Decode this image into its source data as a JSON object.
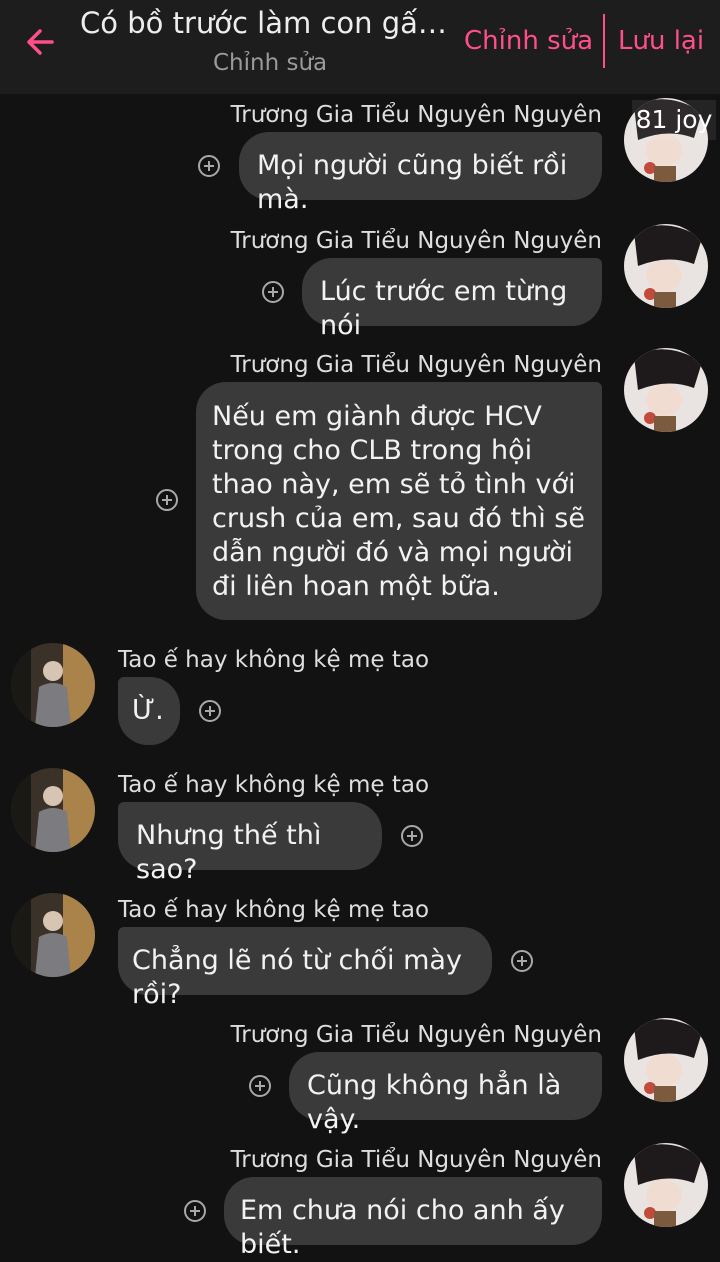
{
  "header": {
    "title": "Có bồ trước làm con gấu ...",
    "subtitle": "Chỉnh sửa",
    "edit_label": "Chỉnh sửa",
    "save_label": "Lưu lại"
  },
  "watermark": "81 joy",
  "colors": {
    "accent": "#ff4f8a",
    "bubble": "#3a3a3a",
    "background": "#121212"
  },
  "messages": [
    {
      "side": "right",
      "sender": "Trương Gia Tiểu Nguyên Nguyên",
      "text": "Mọi người cũng biết rồi mà."
    },
    {
      "side": "right",
      "sender": "Trương Gia Tiểu Nguyên Nguyên",
      "text": "Lúc trước em từng nói"
    },
    {
      "side": "right",
      "sender": "Trương Gia Tiểu Nguyên Nguyên",
      "text": "Nếu em giành được HCV trong cho CLB trong hội thao này, em sẽ tỏ tình với crush của em, sau đó thì sẽ dẫn người đó và mọi người đi liên hoan một bữa."
    },
    {
      "side": "left",
      "sender": "Tao ế hay không kệ mẹ tao",
      "text": "Ừ."
    },
    {
      "side": "left",
      "sender": "Tao ế hay không kệ mẹ tao",
      "text": "Nhưng thế thì sao?"
    },
    {
      "side": "left",
      "sender": "Tao ế hay không kệ mẹ tao",
      "text": "Chẳng lẽ nó từ chối mày rồi?"
    },
    {
      "side": "right",
      "sender": "Trương Gia Tiểu Nguyên Nguyên",
      "text": "Cũng không hẳn là vậy."
    },
    {
      "side": "right",
      "sender": "Trương Gia Tiểu Nguyên Nguyên",
      "text": "Em chưa nói cho anh ấy biết."
    }
  ]
}
